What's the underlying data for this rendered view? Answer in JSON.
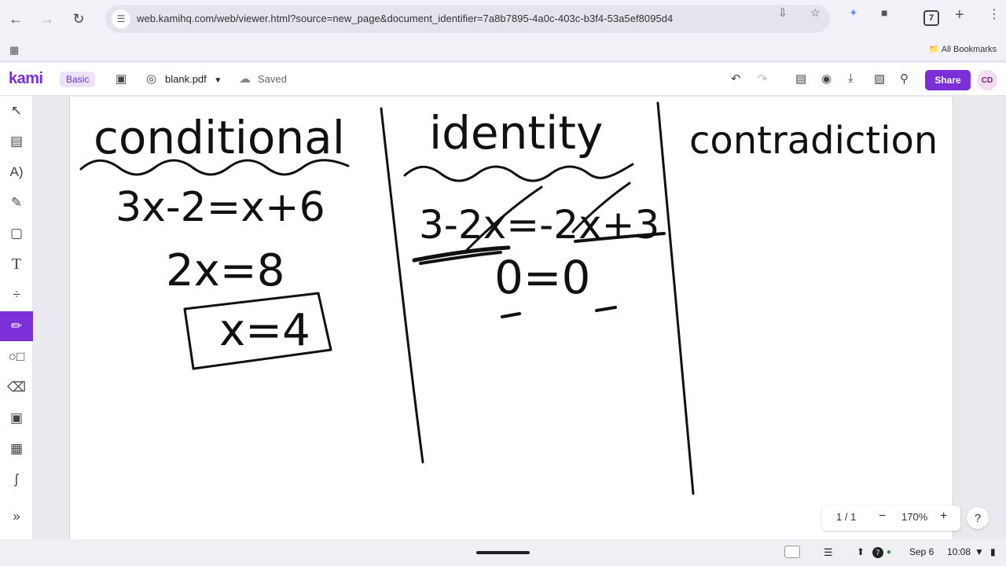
{
  "browser": {
    "url": "web.kamihq.com/web/viewer.html?source=new_page&document_identifier=7a8b7895-4a0c-403c-b3f4-53a5ef8095d4",
    "tab_count": "7",
    "bookmarks_label": "All Bookmarks"
  },
  "kami": {
    "logo": "kami",
    "plan_badge": "Basic",
    "file_name": "blank.pdf",
    "save_status": "Saved",
    "share_label": "Share",
    "user_initials": "CD",
    "accent_color": "#7b2fd6"
  },
  "sidebar": {
    "tools": [
      "select-icon",
      "text-annotate-icon",
      "read-aloud-icon",
      "highlighter-icon",
      "comment-icon",
      "text-icon",
      "equation-icon",
      "pen-icon",
      "shapes-icon",
      "eraser-icon",
      "ai-question-icon",
      "image-icon",
      "signature-icon",
      "expand-icon"
    ],
    "active_tool": "pen-icon"
  },
  "document": {
    "headings": [
      "conditional",
      "identity",
      "contradiction"
    ],
    "conditional_lines": [
      "3x-2=x+6",
      "2x=8",
      "x=4"
    ],
    "identity_lines": [
      "3-2x=-2x+3",
      "0=0"
    ]
  },
  "zoom": {
    "page_indicator": "1 / 1",
    "level": "170%",
    "help": "?"
  },
  "shelf": {
    "tray_badge": "7",
    "date": "Sep 6",
    "time": "10:08"
  }
}
